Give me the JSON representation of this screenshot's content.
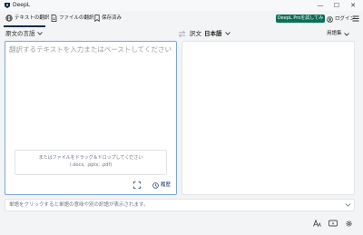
{
  "window": {
    "title": "DeepL",
    "minimize": "—",
    "maximize": "☐",
    "close": "✕"
  },
  "nav": {
    "tabs": [
      {
        "label": "テキストの翻訳",
        "active": true
      },
      {
        "label": "ファイルの翻訳",
        "active": false
      },
      {
        "label": "保存済み",
        "active": false
      }
    ],
    "pro_button": "DeepL Proを試してみる",
    "login": "ログイン"
  },
  "source": {
    "language": "原文の言語",
    "placeholder": "翻訳するテキストを入力またはペーストしてください",
    "drop_line1": "またはファイルをドラッグ＆ドロップしてください",
    "drop_line2": "(.docx, .pptx, .pdf)",
    "history": "履歴"
  },
  "target": {
    "prefix": "訳文",
    "language": "日本語",
    "glossary": "用語集"
  },
  "dictionary": {
    "hint": "単語をクリックすると単語の意味や別の訳語が表示されます。"
  },
  "colors": {
    "accent_green": "#0b6e57",
    "nav_dark": "#0f2b46",
    "focus_border": "#7ca7d6"
  }
}
